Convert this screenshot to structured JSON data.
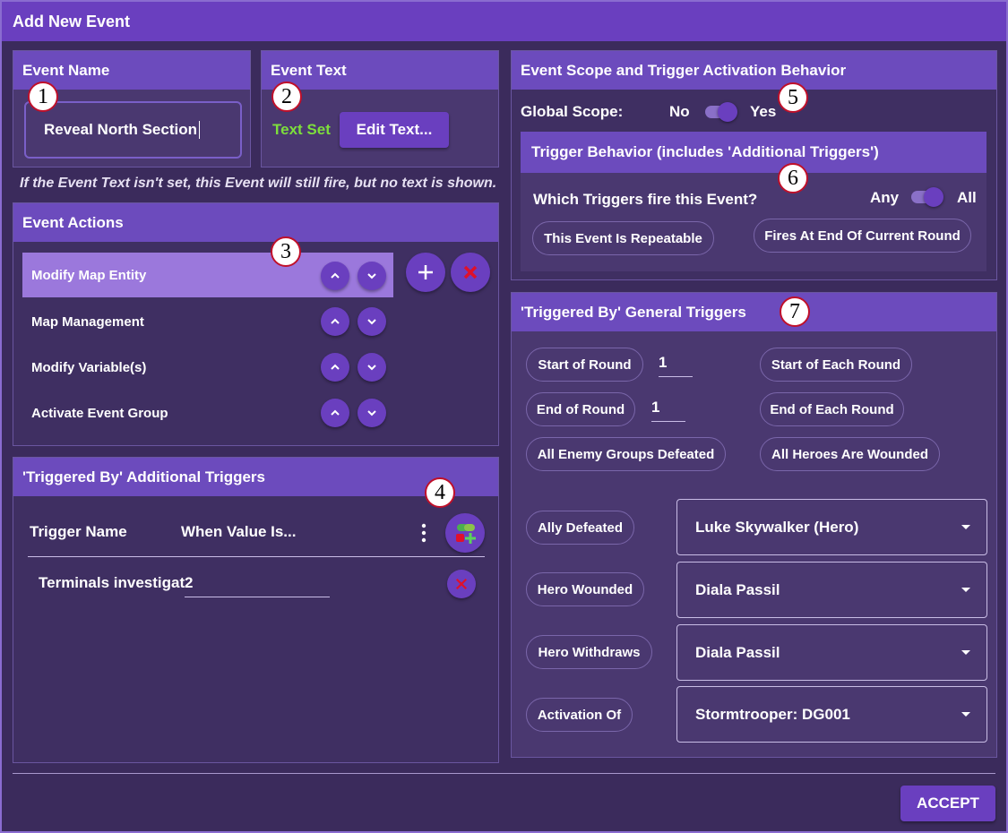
{
  "window": {
    "title": "Add New Event"
  },
  "event_name": {
    "header": "Event Name",
    "value": "Reveal North Section"
  },
  "event_text": {
    "header": "Event Text",
    "status": "Text Set",
    "edit_label": "Edit Text..."
  },
  "note": "If the Event Text isn't set, this Event will still fire, but no text is shown.",
  "event_actions": {
    "header": "Event Actions",
    "items": [
      {
        "label": "Modify Map Entity"
      },
      {
        "label": "Map Management"
      },
      {
        "label": "Modify Variable(s)"
      },
      {
        "label": "Activate Event Group"
      }
    ]
  },
  "additional_triggers": {
    "header": "'Triggered By' Additional Triggers",
    "col_trigger_name": "Trigger Name",
    "col_value": "When Value Is...",
    "rows": [
      {
        "name": "Terminals investigat",
        "value": "2"
      }
    ]
  },
  "scope": {
    "header": "Event Scope and Trigger Activation Behavior",
    "global_label": "Global Scope:",
    "no_label": "No",
    "yes_label": "Yes",
    "behavior_header": "Trigger Behavior (includes 'Additional Triggers')",
    "which_label": "Which Triggers fire this Event?",
    "any_label": "Any",
    "all_label": "All",
    "repeatable_label": "This Event Is Repeatable",
    "end_of_round_label": "Fires At End Of Current Round"
  },
  "general_triggers": {
    "header": "'Triggered By' General Triggers",
    "start_of_round": {
      "label": "Start of Round",
      "value": "1"
    },
    "end_of_round": {
      "label": "End of Round",
      "value": "1"
    },
    "start_each": "Start of Each Round",
    "end_each": "End of Each Round",
    "all_enemy": "All Enemy Groups Defeated",
    "all_heroes": "All Heroes Are Wounded",
    "selects": [
      {
        "label": "Ally Defeated",
        "value": "Luke Skywalker (Hero)"
      },
      {
        "label": "Hero Wounded",
        "value": "Diala Passil"
      },
      {
        "label": "Hero Withdraws",
        "value": "Diala Passil"
      },
      {
        "label": "Activation Of",
        "value": "Stormtrooper: DG001"
      }
    ]
  },
  "callouts": [
    "1",
    "2",
    "3",
    "4",
    "5",
    "6",
    "7"
  ],
  "accept_label": "ACCEPT",
  "colors": {
    "accent": "#6a3fbf",
    "background": "#3b2b5c",
    "panel": "#4a3870",
    "text_set": "#7dde3c",
    "delete": "#e0102a"
  },
  "icons": {
    "up": "chevron-up-icon",
    "down": "chevron-down-icon",
    "add": "plus-icon",
    "remove": "close-icon",
    "menu": "more-vert-icon",
    "add_trigger": "add-trigger-icon"
  }
}
